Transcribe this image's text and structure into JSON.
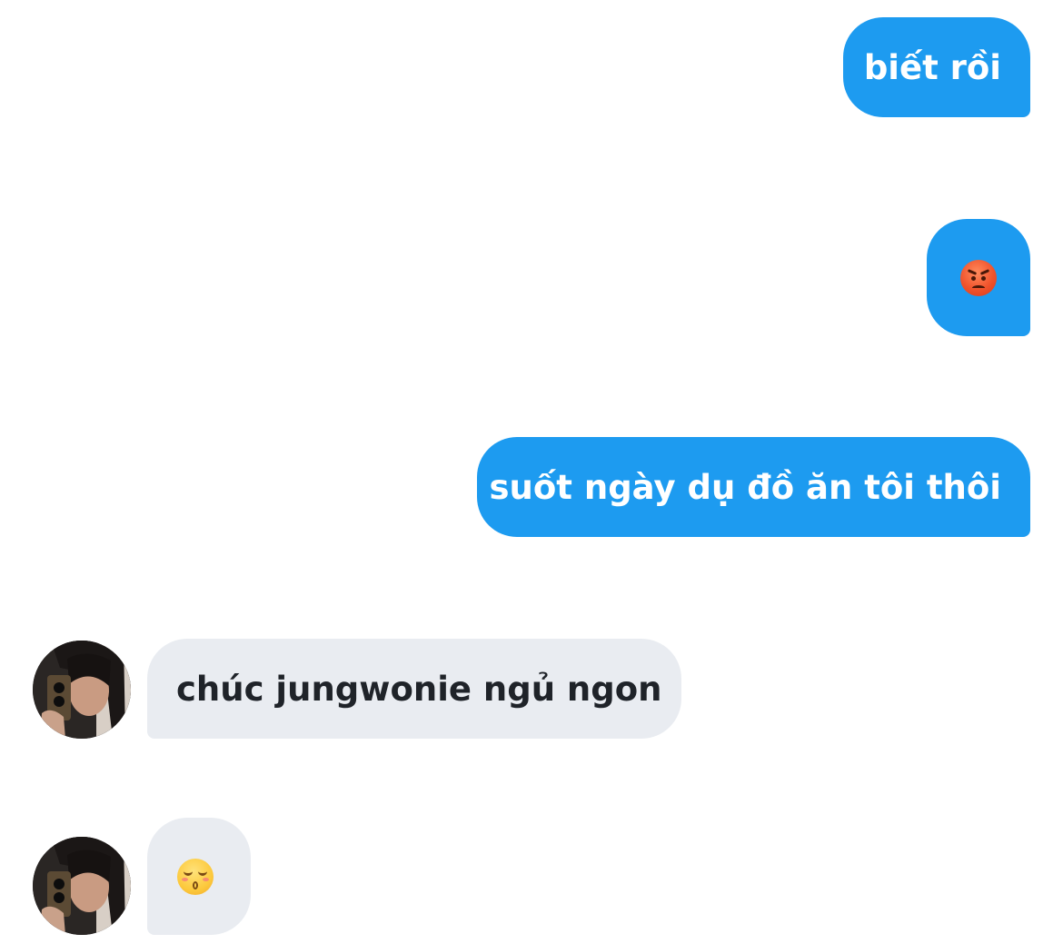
{
  "conversation": {
    "messages": [
      {
        "direction": "outgoing",
        "text": "biết rồi"
      },
      {
        "direction": "outgoing",
        "emoji": "angry-face-icon"
      },
      {
        "direction": "outgoing",
        "text": "suốt ngày dụ đồ ăn tôi thôi"
      },
      {
        "direction": "incoming",
        "text": "chúc jungwonie ngủ ngon"
      },
      {
        "direction": "incoming",
        "emoji": "kissing-smiling-eyes-icon"
      }
    ]
  },
  "colors": {
    "outgoing_bubble": "#1d9bf0",
    "incoming_bubble": "#e9ecf1",
    "outgoing_text": "#ffffff",
    "incoming_text": "#1f2329"
  }
}
